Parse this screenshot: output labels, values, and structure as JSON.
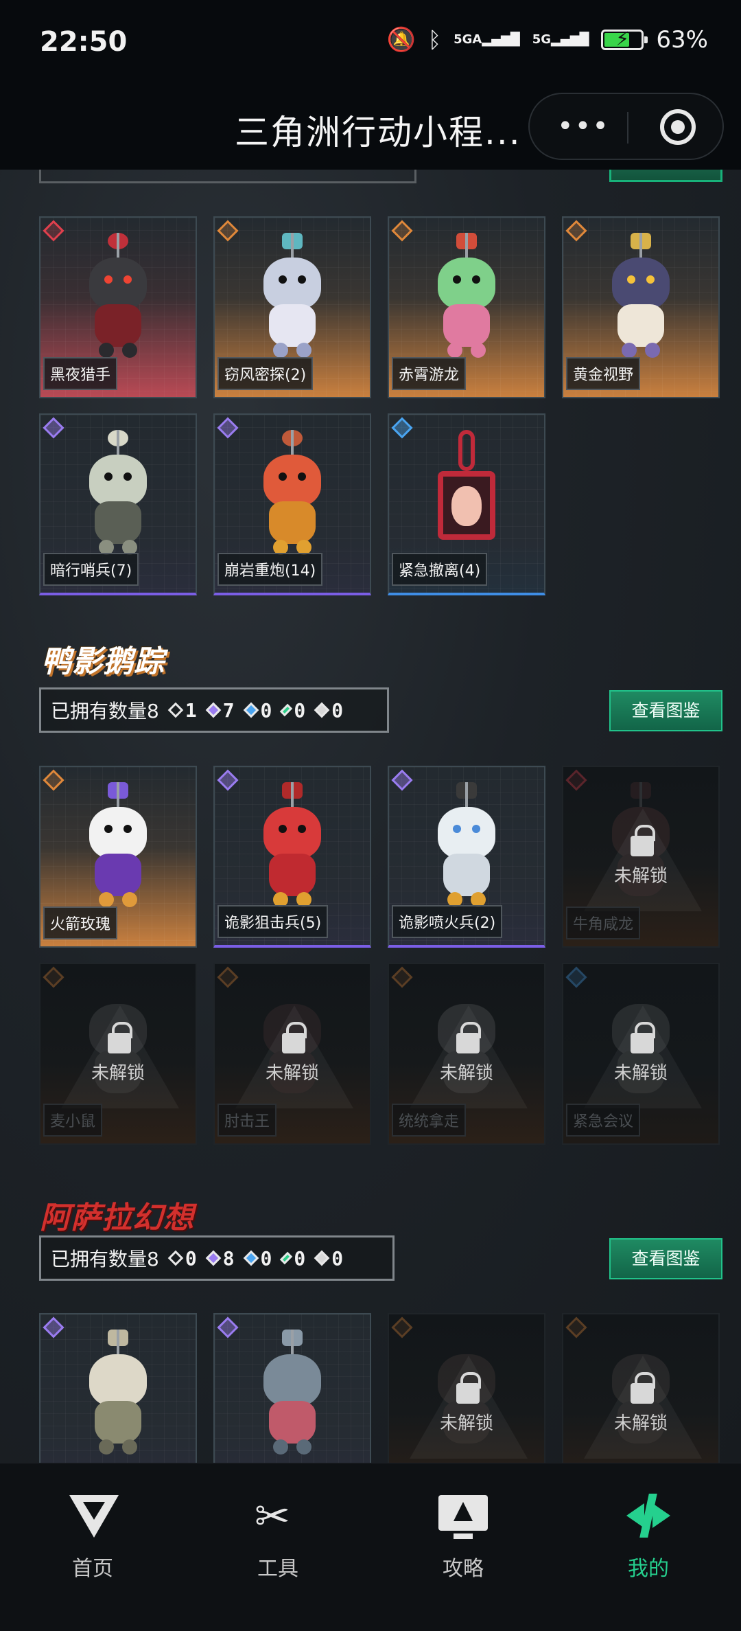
{
  "status_bar": {
    "time": "22:50",
    "network1": "5GA",
    "network2": "5G",
    "battery": "63%",
    "battery_level": 0.63
  },
  "header": {
    "title": "三角洲行动小程...",
    "more_icon": "more-dots-icon",
    "close_icon": "target-close-icon"
  },
  "section1": {
    "items": [
      {
        "name": "黑夜猎手",
        "rarity": "red"
      },
      {
        "name": "窃风密探(2)",
        "rarity": "orange"
      },
      {
        "name": "赤霄游龙",
        "rarity": "orange"
      },
      {
        "name": "黄金视野",
        "rarity": "orange"
      },
      {
        "name": "暗行哨兵(7)",
        "rarity": "purple"
      },
      {
        "name": "崩岩重炮(14)",
        "rarity": "purple"
      },
      {
        "name": "紧急撤离(4)",
        "rarity": "blue"
      }
    ]
  },
  "section2": {
    "logo": "鸭影鹅踪",
    "owned_label": "已拥有数量8",
    "counts": {
      "orange": "1",
      "purple": "7",
      "blue": "0",
      "green": "0",
      "white": "0"
    },
    "view_button": "查看图鉴",
    "items": [
      {
        "name": "火箭玫瑰",
        "rarity": "orange",
        "locked": false
      },
      {
        "name": "诡影狙击兵(5)",
        "rarity": "purple",
        "locked": false
      },
      {
        "name": "诡影喷火兵(2)",
        "rarity": "purple",
        "locked": false
      },
      {
        "name": "牛角咸龙",
        "rarity": "red",
        "locked": true
      },
      {
        "name": "麦小鼠",
        "rarity": "orange",
        "locked": true
      },
      {
        "name": "肘击王",
        "rarity": "orange",
        "locked": true
      },
      {
        "name": "统统拿走",
        "rarity": "orange",
        "locked": true
      },
      {
        "name": "紧急会议",
        "rarity": "blue",
        "locked": true
      }
    ],
    "locked_text": "未解锁"
  },
  "section3": {
    "logo": "阿萨拉幻想",
    "owned_label": "已拥有数量8",
    "counts": {
      "orange": "0",
      "purple": "8",
      "blue": "0",
      "green": "0",
      "white": "0"
    },
    "view_button": "查看图鉴",
    "locked_text": "未解锁"
  },
  "tabbar": {
    "tabs": [
      {
        "label": "首页",
        "icon": "home-v-icon"
      },
      {
        "label": "工具",
        "icon": "tools-icon"
      },
      {
        "label": "攻略",
        "icon": "guide-screen-icon"
      },
      {
        "label": "我的",
        "icon": "profile-logo-icon",
        "active": true
      }
    ]
  },
  "colors": {
    "accent_green": "#25d08e",
    "rarity_red": "#e0404d",
    "rarity_orange": "#e0883a",
    "rarity_purple": "#9a7cf0",
    "rarity_blue": "#4aa4f0"
  }
}
